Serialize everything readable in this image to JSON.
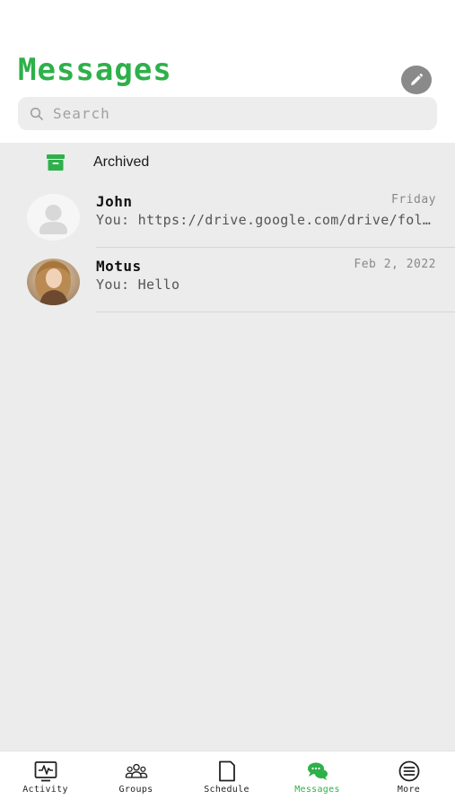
{
  "header": {
    "title": "Messages",
    "search_placeholder": "Search"
  },
  "archived": {
    "label": "Archived"
  },
  "conversations": [
    {
      "name": "John",
      "preview": "You: https://drive.google.com/drive/folders/",
      "time": "Friday"
    },
    {
      "name": "Motus",
      "preview": "You: Hello",
      "time": "Feb 2, 2022"
    }
  ],
  "tabs": [
    {
      "label": "Activity",
      "icon": "activity-icon"
    },
    {
      "label": "Groups",
      "icon": "groups-icon"
    },
    {
      "label": "Schedule",
      "icon": "schedule-icon"
    },
    {
      "label": "Messages",
      "icon": "messages-icon",
      "active": true
    },
    {
      "label": "More",
      "icon": "more-icon"
    }
  ],
  "colors": {
    "accent": "#2eb04a",
    "background": "#ececec"
  }
}
